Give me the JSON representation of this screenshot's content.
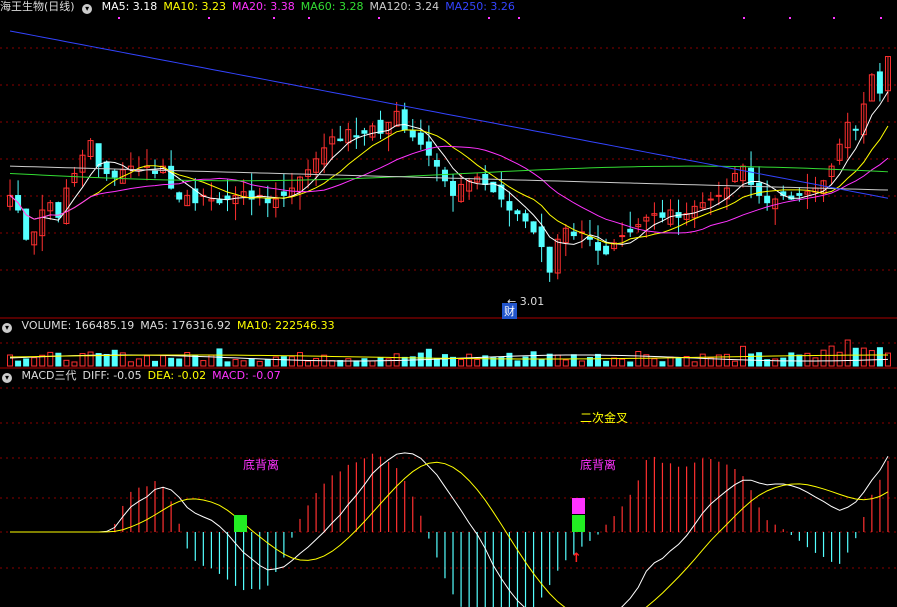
{
  "price_panel": {
    "title": "海王生物(日线)",
    "ma_labels": [
      {
        "text": "MA5: 3.18",
        "color": "#ffffff"
      },
      {
        "text": "MA10: 3.23",
        "color": "#ffff00"
      },
      {
        "text": "MA20: 3.38",
        "color": "#ff33ff"
      },
      {
        "text": "MA60: 3.28",
        "color": "#33dd33"
      },
      {
        "text": "MA120: 3.24",
        "color": "#cccccc"
      },
      {
        "text": "MA250: 3.26",
        "color": "#3344ff"
      }
    ],
    "low_marker": "3.01",
    "event_badge": "财"
  },
  "volume_panel": {
    "labels": [
      {
        "text": "VOLUME: 166485.19",
        "color": "#dddddd"
      },
      {
        "text": "MA5: 176316.92",
        "color": "#dddddd"
      },
      {
        "text": "MA10: 222546.33",
        "color": "#ffff00"
      }
    ]
  },
  "macd_panel": {
    "labels": [
      {
        "text": "MACD三代",
        "color": "#dddddd"
      },
      {
        "text": "DIFF: -0.05",
        "color": "#dddddd"
      },
      {
        "text": "DEA: -0.02",
        "color": "#ffff00"
      },
      {
        "text": "MACD: -0.07",
        "color": "#ff33ff"
      }
    ],
    "annotations": {
      "second_golden_cross": "二次金叉",
      "bottom_divergence_1": "底背离",
      "bottom_divergence_2": "底背离"
    },
    "signal_arrow": "↑"
  },
  "colors": {
    "up": "#ff3030",
    "down": "#54ffff",
    "grid": "#8a0000",
    "ma5": "#ffffff",
    "ma10": "#ffff00",
    "ma20": "#ff33ff",
    "ma60": "#33dd33",
    "ma120": "#cccccc",
    "ma250": "#3344ff"
  },
  "chart_data": {
    "type": "candlestick",
    "closes": [
      3.22,
      3.18,
      3.1,
      3.12,
      3.18,
      3.2,
      3.16,
      3.24,
      3.28,
      3.33,
      3.37,
      3.3,
      3.28,
      3.27,
      3.29,
      3.3,
      3.29,
      3.3,
      3.28,
      3.3,
      3.24,
      3.21,
      3.22,
      3.2,
      3.22,
      3.21,
      3.2,
      3.21,
      3.22,
      3.23,
      3.21,
      3.22,
      3.2,
      3.21,
      3.22,
      3.24,
      3.27,
      3.29,
      3.32,
      3.35,
      3.38,
      3.37,
      3.4,
      3.38,
      3.39,
      3.41,
      3.39,
      3.42,
      3.45,
      3.4,
      3.38,
      3.36,
      3.33,
      3.3,
      3.26,
      3.22,
      3.25,
      3.26,
      3.27,
      3.25,
      3.23,
      3.21,
      3.18,
      3.17,
      3.15,
      3.12,
      3.08,
      3.01,
      3.1,
      3.13,
      3.11,
      3.12,
      3.1,
      3.07,
      3.06,
      3.09,
      3.11,
      3.12,
      3.14,
      3.16,
      3.17,
      3.16,
      3.18,
      3.16,
      3.17,
      3.19,
      3.2,
      3.21,
      3.22,
      3.24,
      3.28,
      3.3,
      3.25,
      3.22,
      3.2,
      3.21,
      3.22,
      3.21,
      3.22,
      3.23,
      3.24,
      3.26,
      3.3,
      3.36,
      3.42,
      3.4,
      3.47,
      3.55,
      3.5,
      3.6
    ],
    "price_range": [
      2.92,
      3.7
    ],
    "volume_ma5": 176316.92,
    "volume_ma10": 222546.33,
    "last_volume": 166485.19
  }
}
